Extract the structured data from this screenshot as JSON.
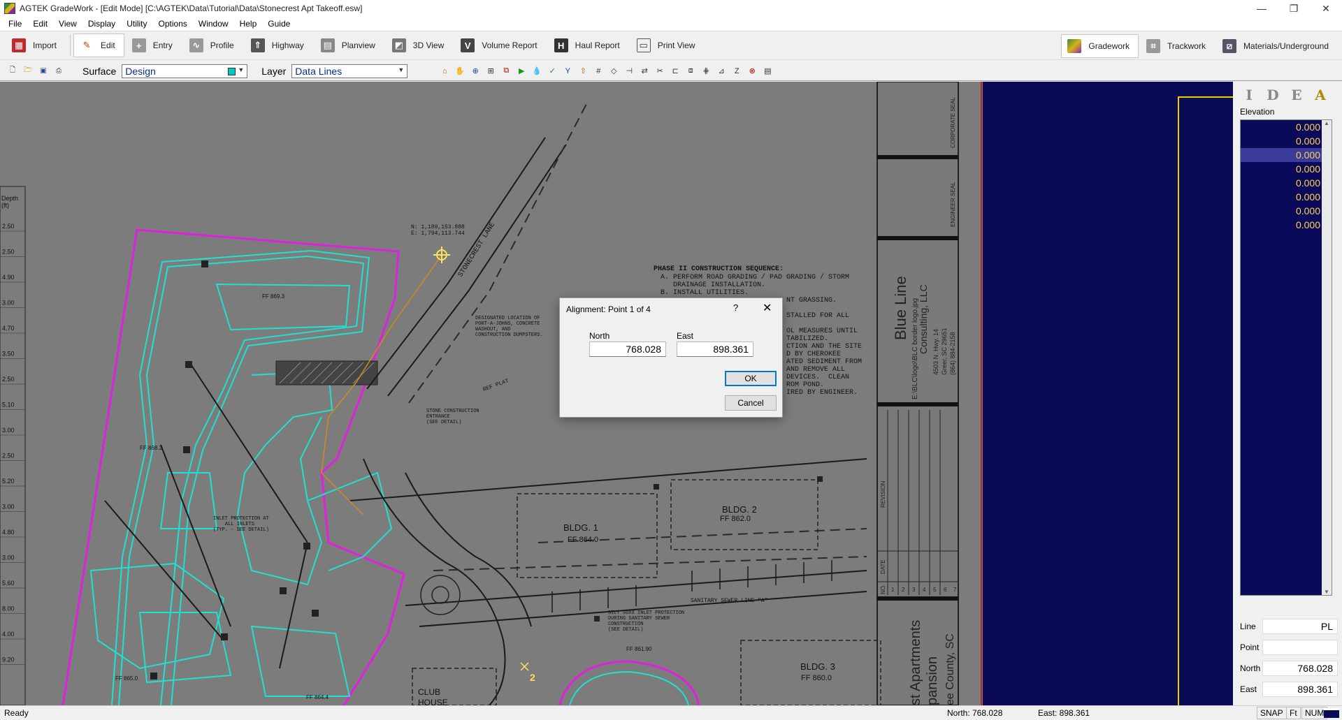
{
  "window": {
    "title": "AGTEK GradeWork - [Edit Mode]  [C:\\AGTEK\\Data\\Tutorial\\Data\\Stonecrest Apt Takeoff.esw]",
    "minimize": "—",
    "maximize": "❐",
    "close": "✕"
  },
  "menu": [
    "File",
    "Edit",
    "View",
    "Display",
    "Utility",
    "Options",
    "Window",
    "Help",
    "Guide"
  ],
  "toolbar": {
    "buttons": [
      {
        "label": "Import",
        "icon": "import-icon"
      },
      {
        "label": "Edit",
        "icon": "pencil-icon",
        "active": true
      },
      {
        "label": "Entry",
        "icon": "entry-icon"
      },
      {
        "label": "Profile",
        "icon": "profile-icon"
      },
      {
        "label": "Highway",
        "icon": "highway-icon"
      },
      {
        "label": "Planview",
        "icon": "planview-icon"
      },
      {
        "label": "3D View",
        "icon": "3d-view-icon"
      },
      {
        "label": "Volume Report",
        "icon": "volume-report-icon"
      },
      {
        "label": "Haul Report",
        "icon": "haul-report-icon"
      },
      {
        "label": "Print View",
        "icon": "print-view-icon"
      }
    ],
    "modules": [
      {
        "label": "Gradework",
        "active": true
      },
      {
        "label": "Trackwork"
      },
      {
        "label": "Materials/Underground"
      }
    ]
  },
  "subtoolbar": {
    "surface_label": "Surface",
    "surface_value": "Design",
    "layer_label": "Layer",
    "layer_value": "Data Lines",
    "accent_color": "#00c8c8"
  },
  "plan": {
    "left_column": {
      "header": "Depth\n(ft)",
      "values": [
        "2.50",
        "2.50",
        "4.90",
        "3.00",
        "4.70",
        "3.50",
        "2.50",
        "5.10",
        "3.00",
        "2.50",
        "5.20",
        "3.00",
        "4.80",
        "3.00",
        "5.60",
        "8.00",
        "4.00",
        "9.20"
      ]
    },
    "coord_note": [
      "N: 1,189,153.888",
      "E: 1,794,113.744"
    ],
    "street": "STONECREST LANE",
    "sequence_title": "PHASE II CONSTRUCTION SEQUENCE:",
    "sequence_lines": [
      "A. PERFORM ROAD GRADING / PAD GRADING / STORM",
      "   DRAINAGE INSTALLATION.",
      "B. INSTALL UTILITIES.",
      "                              NT GRASSING.",
      "",
      "                              STALLED FOR ALL",
      "",
      "                              OL MEASURES UNTIL",
      "                              TABILIZED.",
      "                              CTION AND THE SITE",
      "                              D BY CHEROKEE",
      "                              ATED SEDIMENT FROM",
      "                              AND REMOVE ALL",
      "                              DEVICES.  CLEAN",
      "                              ROM POND.",
      "                              IRED BY ENGINEER."
    ],
    "notes": {
      "port_a_john": [
        "DESIGNATED LOCATION OF",
        "PORT-A-JOHNS, CONCRETE",
        "WASHOUT, AND",
        "CONSTRUCTION DUMPSTERS."
      ],
      "stone_entrance": [
        "STONE CONSTRUCTION",
        "ENTRANCE",
        "(SEE DETAIL)"
      ],
      "inlet_protection": [
        "INLET PROTECTION AT",
        "ALL INLETS",
        "(TYP. - SEE DETAIL)"
      ],
      "silt_soxx": [
        "SILT SOXX INLET PROTECTION",
        "DURING SANITARY SEWER",
        "CONSTRUCTION",
        "(SEE DETAIL)"
      ],
      "sanitary": "SANITARY SEWER LINE \"A\"",
      "ref_plat": "REF PLAT"
    },
    "buildings": [
      {
        "name": "BLDG. 1",
        "ff": "FF 864.0"
      },
      {
        "name": "BLDG. 2",
        "ff": "FF 862.0"
      },
      {
        "name": "BLDG. 3",
        "ff": "FF 860.0"
      },
      {
        "name": "CLUB",
        "ff": "HOUSE"
      }
    ],
    "ff_labels": [
      "FF 869.3",
      "FF 868.2",
      "FF 865.0",
      "FF 864.4",
      "FF 861.90"
    ],
    "title_block": {
      "corporate_seal": "CORPORATE SEAL",
      "engineer_seal": "ENGINEER SEAL",
      "firm_name": "Blue Line",
      "firm_sub": "Consulting, LLC",
      "firm_logo": "E:\\BLC\\logo\\BLC border logo.jpg",
      "address": [
        "4503 N. Hwy. 14",
        "Greer, SC 29651",
        "(864) 884-2158"
      ],
      "revision": "REVISION",
      "date": "DATE",
      "no": "NO.",
      "numbers": [
        "1",
        "2",
        "3",
        "4",
        "5",
        "6",
        "7"
      ],
      "project": "st Apartments",
      "project2": "pansion",
      "county": "ee County, SC"
    }
  },
  "right_panel": {
    "tabs": [
      "I",
      "D",
      "E",
      "A"
    ],
    "elevation_label": "Elevation",
    "elevations": [
      "0.000",
      "0.000",
      "0.000",
      "0.000",
      "0.000",
      "0.000",
      "0.000",
      "0.000"
    ],
    "selected_index": 2,
    "fields": [
      {
        "label": "Line",
        "value": "PL"
      },
      {
        "label": "Point",
        "value": ""
      },
      {
        "label": "North",
        "value": "768.028"
      },
      {
        "label": "East",
        "value": "898.361"
      }
    ]
  },
  "dialog": {
    "title": "Alignment: Point 1 of 4",
    "help": "?",
    "close": "✕",
    "north_label": "North",
    "north_value": "768.028",
    "east_label": "East",
    "east_value": "898.361",
    "ok": "OK",
    "cancel": "Cancel"
  },
  "status": {
    "text": "Ready",
    "north": "North: 768.028",
    "east": "East: 898.361",
    "indicators": [
      "SNAP",
      "Ft",
      "NUM"
    ]
  }
}
